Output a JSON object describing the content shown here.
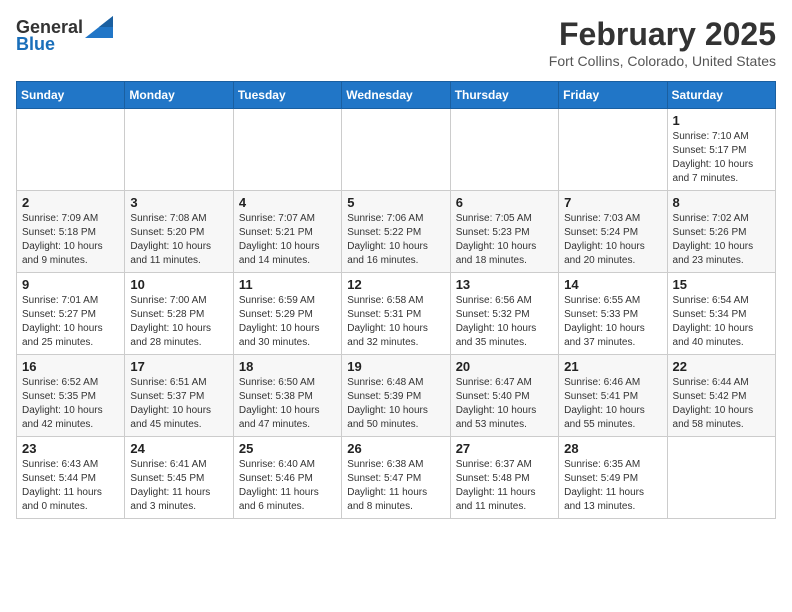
{
  "header": {
    "logo_general": "General",
    "logo_blue": "Blue",
    "month_year": "February 2025",
    "location": "Fort Collins, Colorado, United States"
  },
  "weekdays": [
    "Sunday",
    "Monday",
    "Tuesday",
    "Wednesday",
    "Thursday",
    "Friday",
    "Saturday"
  ],
  "weeks": [
    [
      null,
      null,
      null,
      null,
      null,
      null,
      {
        "day": "1",
        "sunrise": "7:10 AM",
        "sunset": "5:17 PM",
        "daylight": "10 hours and 7 minutes."
      }
    ],
    [
      {
        "day": "2",
        "sunrise": "7:09 AM",
        "sunset": "5:18 PM",
        "daylight": "10 hours and 9 minutes."
      },
      {
        "day": "3",
        "sunrise": "7:08 AM",
        "sunset": "5:20 PM",
        "daylight": "10 hours and 11 minutes."
      },
      {
        "day": "4",
        "sunrise": "7:07 AM",
        "sunset": "5:21 PM",
        "daylight": "10 hours and 14 minutes."
      },
      {
        "day": "5",
        "sunrise": "7:06 AM",
        "sunset": "5:22 PM",
        "daylight": "10 hours and 16 minutes."
      },
      {
        "day": "6",
        "sunrise": "7:05 AM",
        "sunset": "5:23 PM",
        "daylight": "10 hours and 18 minutes."
      },
      {
        "day": "7",
        "sunrise": "7:03 AM",
        "sunset": "5:24 PM",
        "daylight": "10 hours and 20 minutes."
      },
      {
        "day": "8",
        "sunrise": "7:02 AM",
        "sunset": "5:26 PM",
        "daylight": "10 hours and 23 minutes."
      }
    ],
    [
      {
        "day": "9",
        "sunrise": "7:01 AM",
        "sunset": "5:27 PM",
        "daylight": "10 hours and 25 minutes."
      },
      {
        "day": "10",
        "sunrise": "7:00 AM",
        "sunset": "5:28 PM",
        "daylight": "10 hours and 28 minutes."
      },
      {
        "day": "11",
        "sunrise": "6:59 AM",
        "sunset": "5:29 PM",
        "daylight": "10 hours and 30 minutes."
      },
      {
        "day": "12",
        "sunrise": "6:58 AM",
        "sunset": "5:31 PM",
        "daylight": "10 hours and 32 minutes."
      },
      {
        "day": "13",
        "sunrise": "6:56 AM",
        "sunset": "5:32 PM",
        "daylight": "10 hours and 35 minutes."
      },
      {
        "day": "14",
        "sunrise": "6:55 AM",
        "sunset": "5:33 PM",
        "daylight": "10 hours and 37 minutes."
      },
      {
        "day": "15",
        "sunrise": "6:54 AM",
        "sunset": "5:34 PM",
        "daylight": "10 hours and 40 minutes."
      }
    ],
    [
      {
        "day": "16",
        "sunrise": "6:52 AM",
        "sunset": "5:35 PM",
        "daylight": "10 hours and 42 minutes."
      },
      {
        "day": "17",
        "sunrise": "6:51 AM",
        "sunset": "5:37 PM",
        "daylight": "10 hours and 45 minutes."
      },
      {
        "day": "18",
        "sunrise": "6:50 AM",
        "sunset": "5:38 PM",
        "daylight": "10 hours and 47 minutes."
      },
      {
        "day": "19",
        "sunrise": "6:48 AM",
        "sunset": "5:39 PM",
        "daylight": "10 hours and 50 minutes."
      },
      {
        "day": "20",
        "sunrise": "6:47 AM",
        "sunset": "5:40 PM",
        "daylight": "10 hours and 53 minutes."
      },
      {
        "day": "21",
        "sunrise": "6:46 AM",
        "sunset": "5:41 PM",
        "daylight": "10 hours and 55 minutes."
      },
      {
        "day": "22",
        "sunrise": "6:44 AM",
        "sunset": "5:42 PM",
        "daylight": "10 hours and 58 minutes."
      }
    ],
    [
      {
        "day": "23",
        "sunrise": "6:43 AM",
        "sunset": "5:44 PM",
        "daylight": "11 hours and 0 minutes."
      },
      {
        "day": "24",
        "sunrise": "6:41 AM",
        "sunset": "5:45 PM",
        "daylight": "11 hours and 3 minutes."
      },
      {
        "day": "25",
        "sunrise": "6:40 AM",
        "sunset": "5:46 PM",
        "daylight": "11 hours and 6 minutes."
      },
      {
        "day": "26",
        "sunrise": "6:38 AM",
        "sunset": "5:47 PM",
        "daylight": "11 hours and 8 minutes."
      },
      {
        "day": "27",
        "sunrise": "6:37 AM",
        "sunset": "5:48 PM",
        "daylight": "11 hours and 11 minutes."
      },
      {
        "day": "28",
        "sunrise": "6:35 AM",
        "sunset": "5:49 PM",
        "daylight": "11 hours and 13 minutes."
      },
      null
    ]
  ]
}
